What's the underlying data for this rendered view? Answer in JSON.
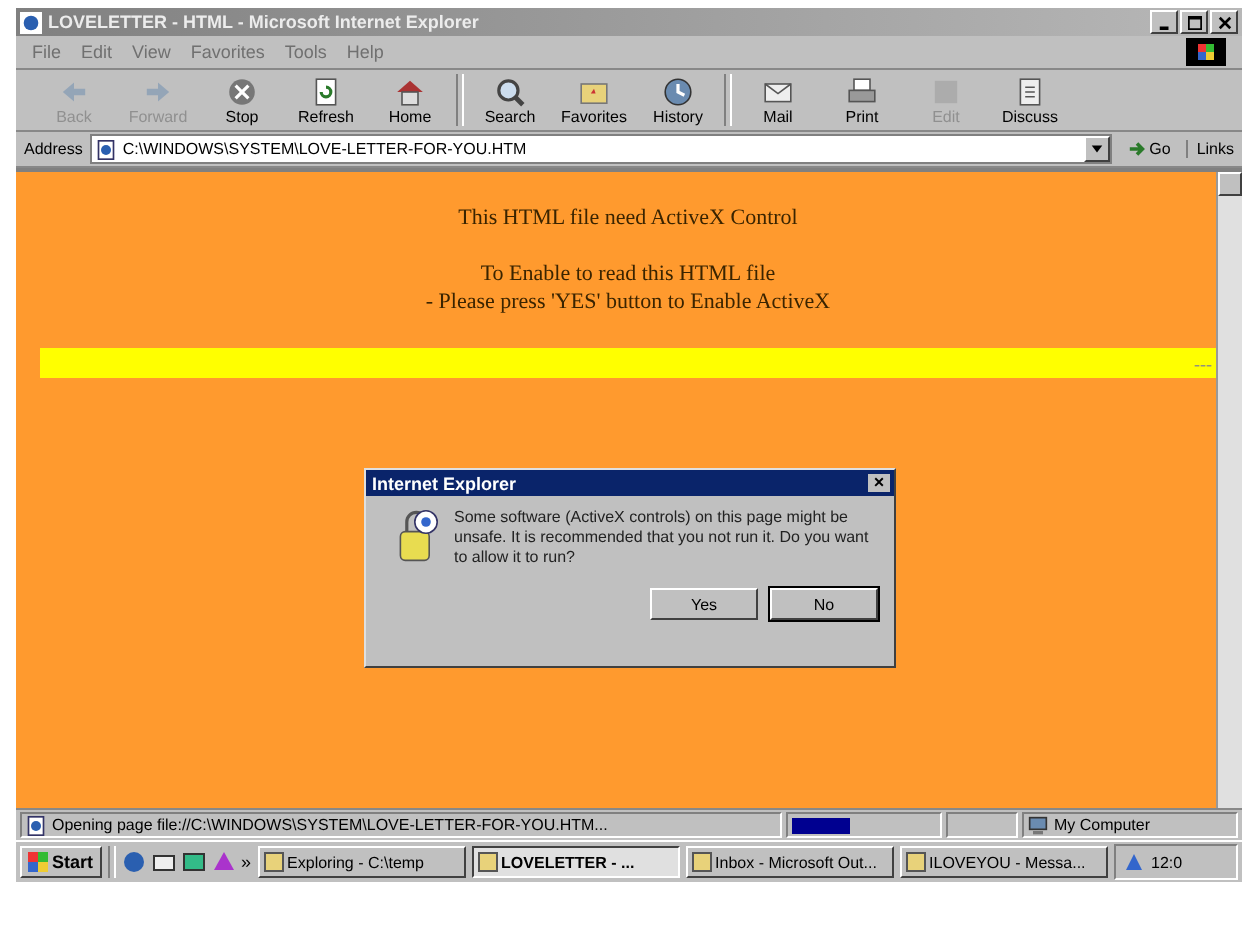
{
  "window": {
    "title": "LOVELETTER - HTML - Microsoft Internet Explorer"
  },
  "menu": [
    "File",
    "Edit",
    "View",
    "Favorites",
    "Tools",
    "Help"
  ],
  "toolbar": [
    {
      "label": "Back",
      "disabled": true
    },
    {
      "label": "Forward",
      "disabled": true
    },
    {
      "label": "Stop",
      "disabled": false
    },
    {
      "label": "Refresh",
      "disabled": false
    },
    {
      "label": "Home",
      "disabled": false
    },
    {
      "label": "Search",
      "disabled": false
    },
    {
      "label": "Favorites",
      "disabled": false
    },
    {
      "label": "History",
      "disabled": false
    },
    {
      "label": "Mail",
      "disabled": false
    },
    {
      "label": "Print",
      "disabled": false
    },
    {
      "label": "Edit",
      "disabled": true
    },
    {
      "label": "Discuss",
      "disabled": false
    }
  ],
  "address": {
    "label": "Address",
    "value": "C:\\WINDOWS\\SYSTEM\\LOVE-LETTER-FOR-YOU.HTM",
    "go": "Go",
    "links": "Links"
  },
  "page": {
    "heading": "This HTML file need ActiveX Control",
    "lines": [
      "To Enable to read this HTML file",
      "- Please press 'YES' button to Enable ActiveX"
    ],
    "bar_text": "---"
  },
  "dialog": {
    "title": "Internet Explorer",
    "close": "×",
    "message": "Some software (ActiveX controls) on this page might be unsafe. It is recommended that you not run it. Do you want to allow it to run?",
    "buttons": [
      {
        "label": "Yes",
        "selected": false
      },
      {
        "label": "No",
        "selected": true
      }
    ]
  },
  "status_bar": {
    "text": "Opening page file://C:\\WINDOWS\\SYSTEM\\LOVE-LETTER-FOR-YOU.HTM...",
    "progress": {
      "level": 0.4
    },
    "zone": "My Computer"
  },
  "taskbar": {
    "start": "Start",
    "more": "»",
    "tasks": [
      {
        "label": "Exploring - C:\\temp",
        "selected": false
      },
      {
        "label": "LOVELETTER - ...",
        "selected": true
      },
      {
        "label": "Inbox - Microsoft Out...",
        "selected": false
      },
      {
        "label": "ILOVEYOU - Messa...",
        "selected": false
      }
    ],
    "clock": "12:0"
  }
}
